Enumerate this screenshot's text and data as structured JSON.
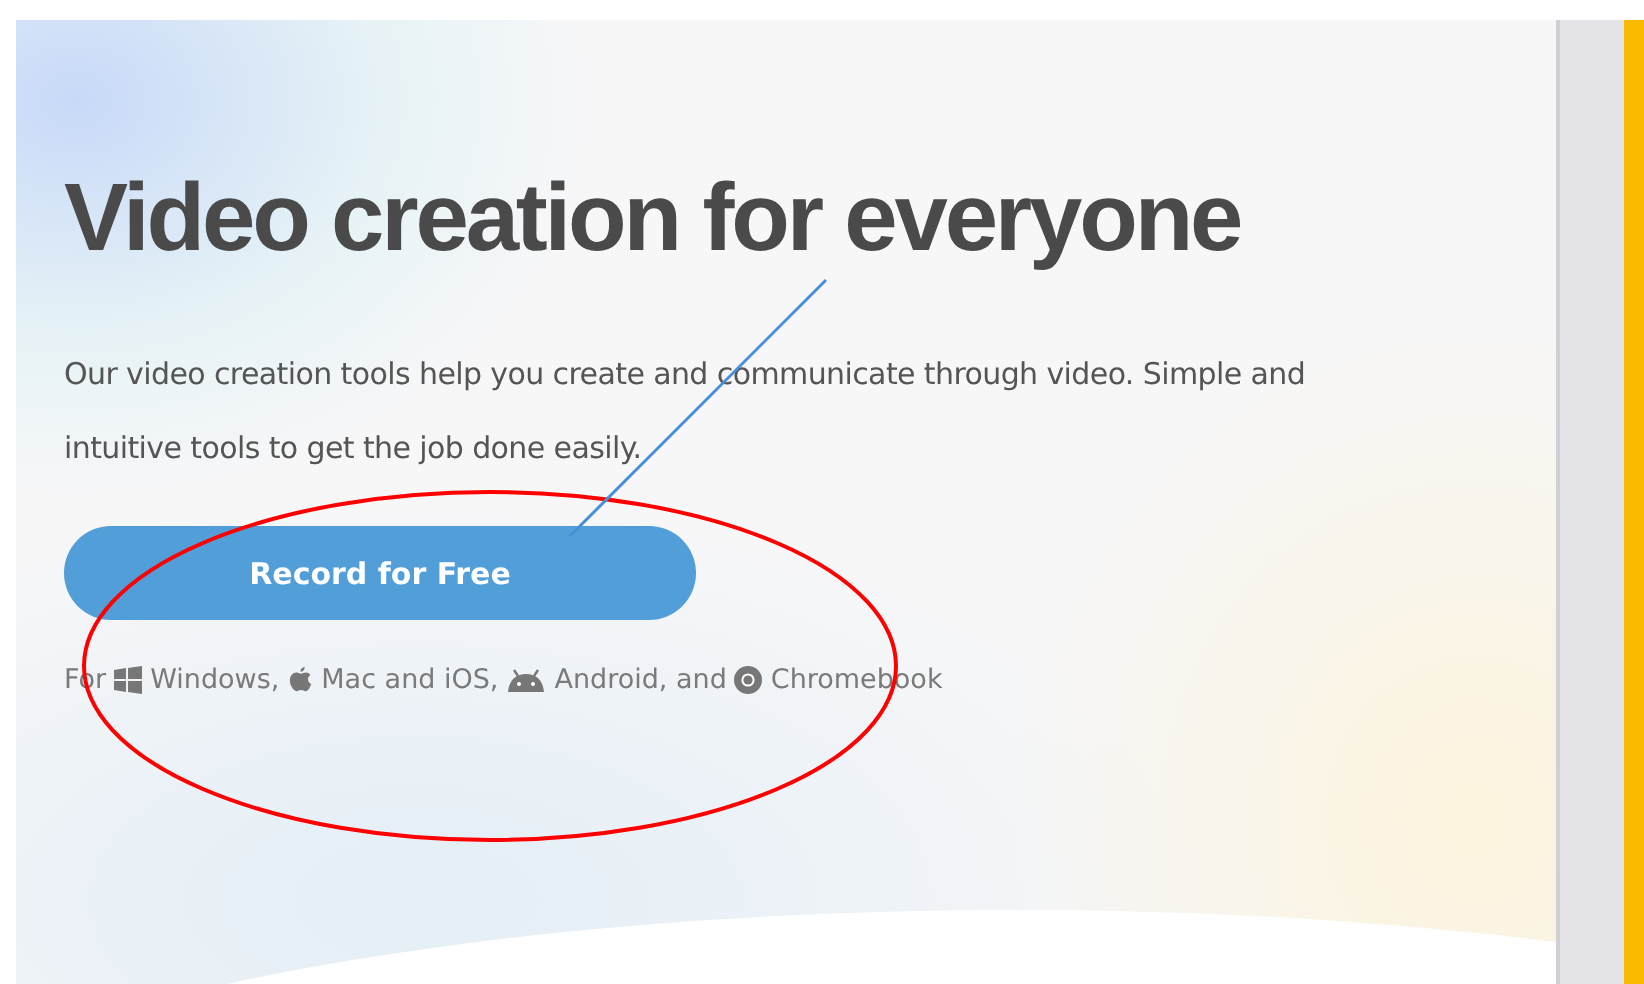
{
  "hero": {
    "headline": "Video creation for everyone",
    "description": "Our video creation tools help you create and communicate through video. Simple and intuitive tools to get the job done easily.",
    "button": "Record for Free",
    "platforms": [
      {
        "kind": "text",
        "label": "For"
      },
      {
        "kind": "windows",
        "label": "Windows,"
      },
      {
        "kind": "apple",
        "label": "Mac and iOS,"
      },
      {
        "kind": "android",
        "label": "Android, and"
      },
      {
        "kind": "chrome",
        "label": "Chromebook"
      }
    ]
  },
  "annotations": [
    {
      "kind": "ellipse",
      "color": "#ff0000"
    },
    {
      "kind": "line",
      "color": "#4a8fd4"
    }
  ]
}
